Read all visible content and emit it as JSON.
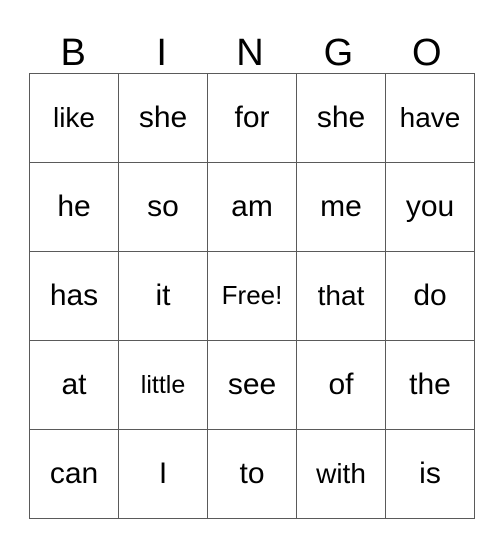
{
  "card": {
    "type": "bingo-card",
    "header": {
      "letters": [
        "B",
        "I",
        "N",
        "G",
        "O"
      ]
    },
    "grid": {
      "rows": 5,
      "columns": 5,
      "free_space": {
        "row": 2,
        "column": 2,
        "label": "Free!"
      },
      "cells": [
        [
          "like",
          "she",
          "for",
          "she",
          "have"
        ],
        [
          "he",
          "so",
          "am",
          "me",
          "you"
        ],
        [
          "has",
          "it",
          "Free!",
          "that",
          "do"
        ],
        [
          "at",
          "little",
          "see",
          "of",
          "the"
        ],
        [
          "can",
          "I",
          "to",
          "with",
          "is"
        ]
      ]
    },
    "colors": {
      "background": "#ffffff",
      "border": "#5a5a5a",
      "text": "#000000"
    }
  }
}
